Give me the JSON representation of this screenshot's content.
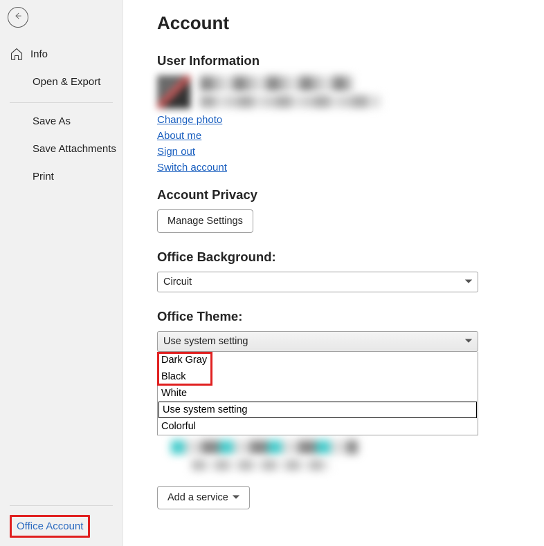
{
  "sidebar": {
    "items": [
      {
        "label": "Info"
      },
      {
        "label": "Open & Export"
      },
      {
        "label": "Save As"
      },
      {
        "label": "Save Attachments"
      },
      {
        "label": "Print"
      }
    ],
    "office_account_label": "Office Account"
  },
  "main": {
    "title": "Account",
    "user_info_heading": "User Information",
    "links": {
      "change_photo": "Change photo",
      "about_me": "About me",
      "sign_out": "Sign out",
      "switch_account": "Switch account"
    },
    "privacy_heading": "Account Privacy",
    "manage_settings_label": "Manage Settings",
    "background_heading": "Office Background:",
    "background_value": "Circuit",
    "theme_heading": "Office Theme:",
    "theme_value": "Use system setting",
    "theme_options": [
      "Dark Gray",
      "Black",
      "White",
      "Use system setting",
      "Colorful"
    ],
    "add_service_label": "Add a service"
  },
  "colors": {
    "link": "#1a5fbf",
    "highlight_border": "#e02020",
    "sidebar_bg": "#f1f1f1"
  }
}
